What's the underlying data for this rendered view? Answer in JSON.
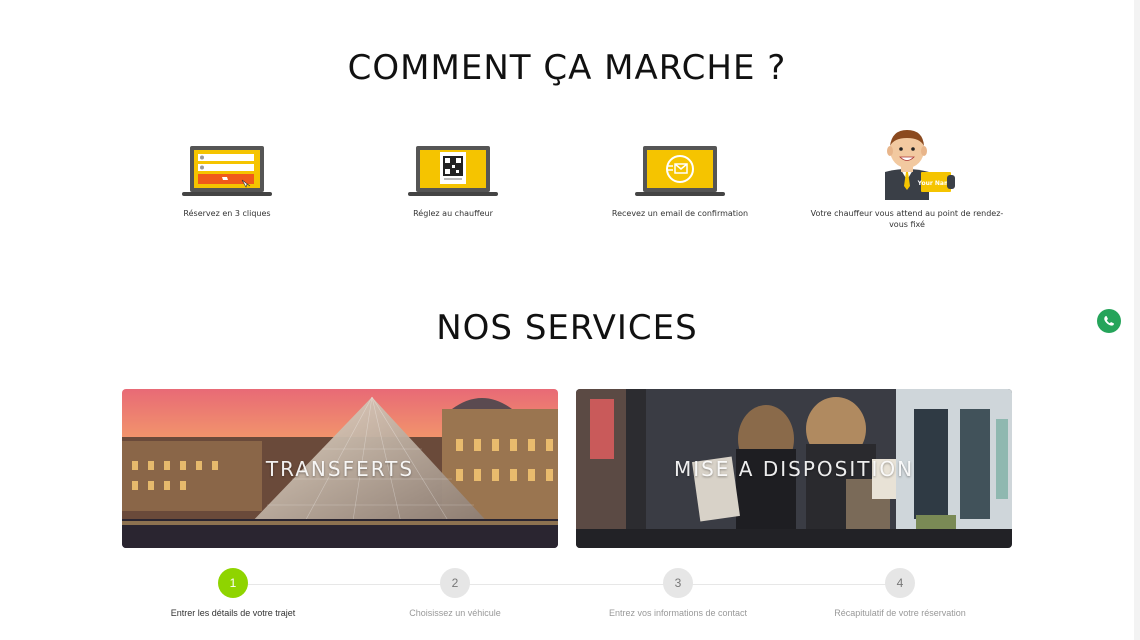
{
  "how_it_works": {
    "title": "COMMENT ÇA MARCHE ?",
    "steps": [
      {
        "caption": "Réservez en 3 cliques",
        "icon": "laptop-booking-form-icon"
      },
      {
        "caption": "Réglez au chauffeur",
        "icon": "laptop-qr-code-icon"
      },
      {
        "caption": "Recevez un email de confirmation",
        "icon": "laptop-email-icon"
      },
      {
        "caption": "Votre chauffeur vous attend au point de rendez-vous fixé",
        "icon": "chauffeur-name-sign-icon",
        "sign_text": "Your Name"
      }
    ]
  },
  "services": {
    "title": "NOS SERVICES",
    "cards": [
      {
        "label": "TRANSFERTS"
      },
      {
        "label": "MISE A DISPOSITION"
      }
    ]
  },
  "booking_steps": [
    {
      "number": "1",
      "label": "Entrer les détails de votre trajet",
      "active": true
    },
    {
      "number": "2",
      "label": "Choisissez un véhicule",
      "active": false
    },
    {
      "number": "3",
      "label": "Entrez vos informations de contact",
      "active": false
    },
    {
      "number": "4",
      "label": "Récapitulatif de votre réservation",
      "active": false
    }
  ],
  "colors": {
    "accent_yellow": "#f5c400",
    "accent_orange": "#f05a1a",
    "active_step": "#8fd400",
    "whatsapp": "#25a45a"
  }
}
